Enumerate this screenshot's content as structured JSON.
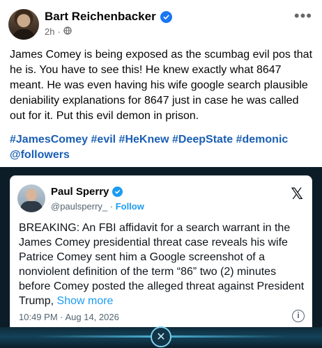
{
  "post": {
    "author": "Bart Reichenbacker",
    "time": "2h",
    "privacy_icon": "globe-icon",
    "menu_icon": "more-horizontal-icon",
    "text": "James Comey is being exposed as the scumbag evil pos that he is. You have to see this! He knew exactly what 8647 meant. He was even having his wife google search plausible deniability explanations for 8647 just in case he was called out for it. Put this evil demon in prison.",
    "hashtags": "#JamesComey #evil #HeKnew #DeepState #demonic @followers"
  },
  "embed": {
    "name": "Paul Sperry",
    "handle": "@paulsperry_",
    "separator": " · ",
    "follow": "Follow",
    "platform_icon": "x-logo-icon",
    "body": "BREAKING: An FBI affidavit for a search warrant in the James Comey presidential threat case reveals his wife Patrice Comey sent him a Google screenshot of a nonviolent definition of the term “86” two (2) minutes before Comey posted the alleged threat against President Trump, ",
    "show_more": "Show more",
    "timestamp": "10:49 PM · Aug 14, 2026",
    "info_icon": "info-icon"
  },
  "colors": {
    "facebook_blue": "#1877f2",
    "hashtag_blue": "#1a5fb4",
    "x_blue": "#1d9bf0",
    "embed_background": "#0c1d27"
  }
}
